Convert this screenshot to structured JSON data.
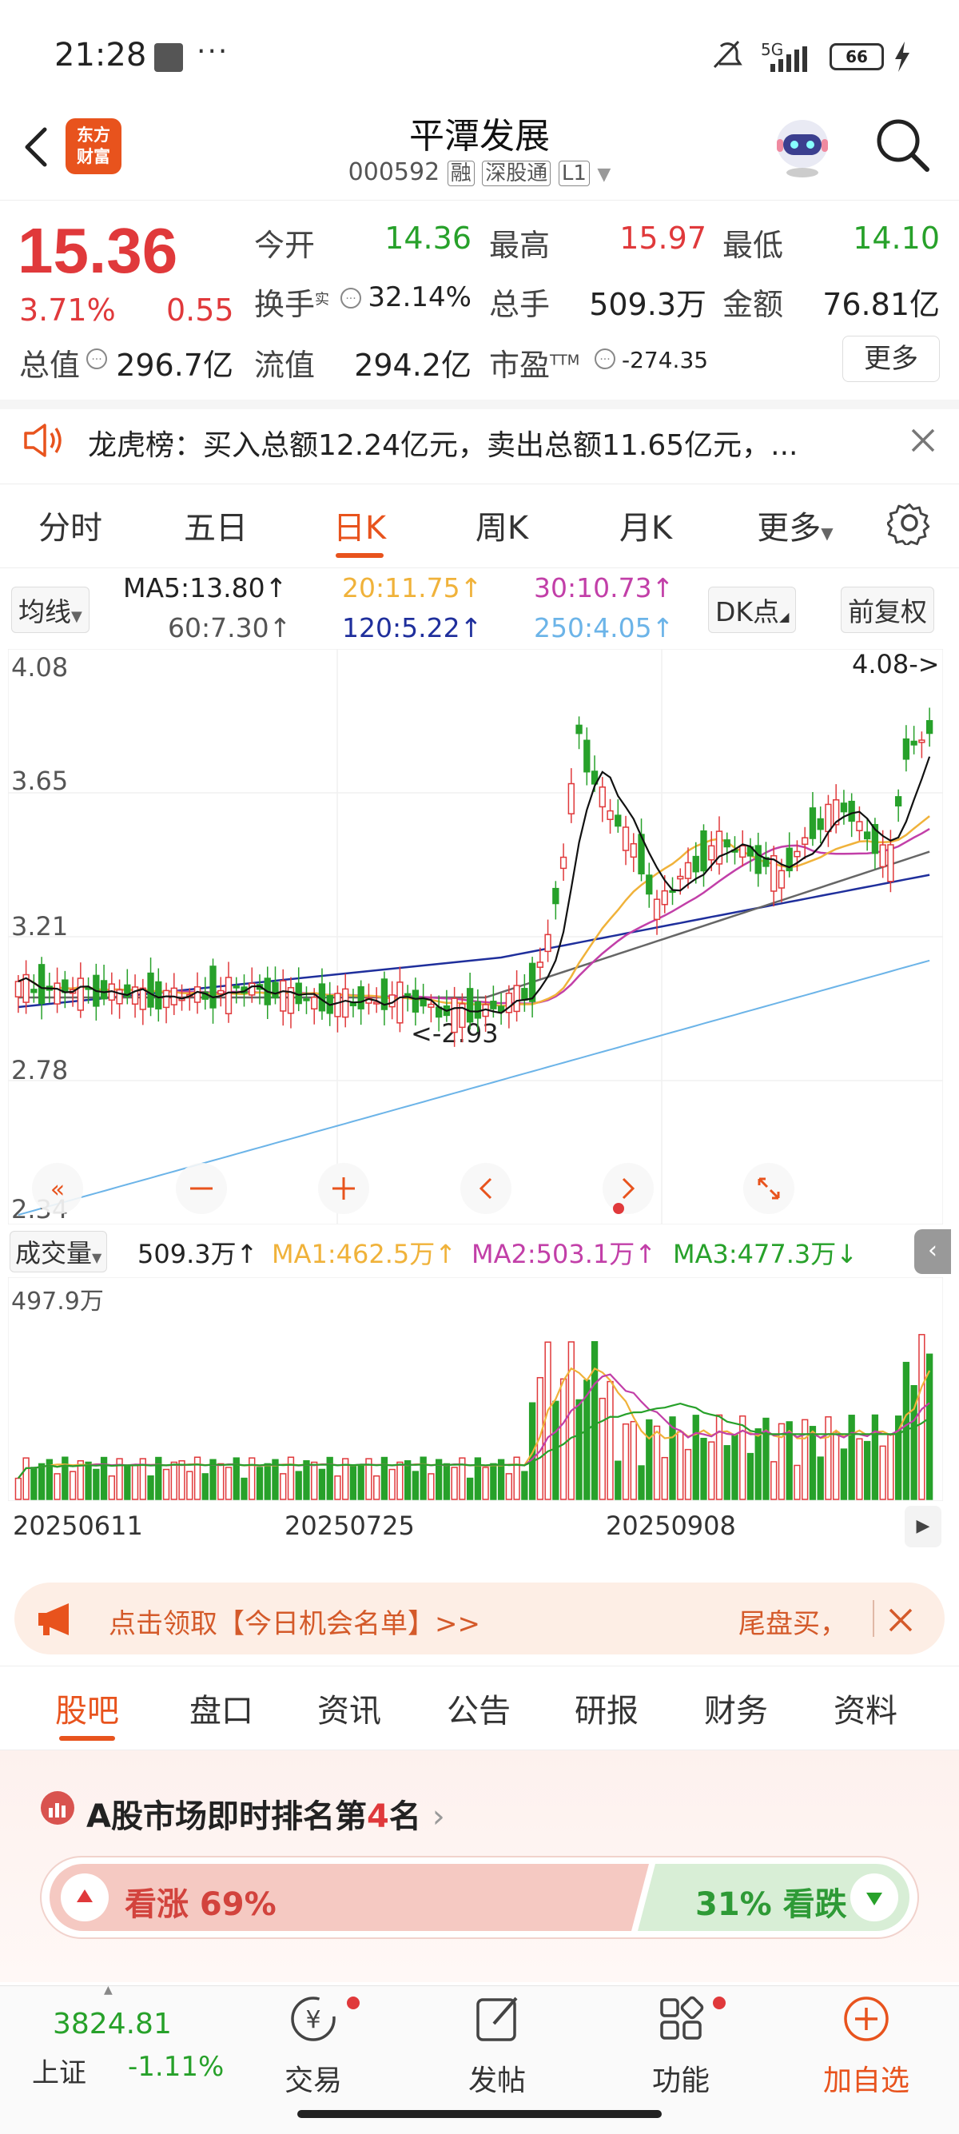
{
  "status_bar": {
    "time": "21:28",
    "dots": "···",
    "network": "5G",
    "battery": "66"
  },
  "header": {
    "logo_line1": "东方",
    "logo_line2": "财富",
    "stock_name": "平潭发展",
    "stock_code": "000592",
    "tag_margin": "融",
    "tag_connect": "深股通",
    "tag_level": "L1"
  },
  "quote": {
    "price": "15.36",
    "change_pct": "3.71%",
    "change_amt": "0.55",
    "items": [
      {
        "label": "今开",
        "value": "14.36",
        "color": "green"
      },
      {
        "label": "最高",
        "value": "15.97",
        "color": "red"
      },
      {
        "label": "最低",
        "value": "14.10",
        "color": "green"
      },
      {
        "label": "换手",
        "sup": "实",
        "value": "32.14%",
        "color": "dark"
      },
      {
        "label": "总手",
        "value": "509.3万",
        "color": "dark"
      },
      {
        "label": "金额",
        "value": "76.81亿",
        "color": "dark"
      },
      {
        "label": "总值",
        "value": "296.7亿",
        "color": "dark"
      },
      {
        "label": "流值",
        "value": "294.2亿",
        "color": "dark"
      },
      {
        "label": "市盈",
        "sup": "TTM",
        "value": "-274.35",
        "color": "dark"
      }
    ],
    "more_label": "更多"
  },
  "notice": {
    "text": "龙虎榜：买入总额12.24亿元，卖出总额11.65亿元，..."
  },
  "period_tabs": [
    "分时",
    "五日",
    "日K",
    "周K",
    "月K",
    "更多"
  ],
  "ma_row": {
    "selector": "均线",
    "ma5": "MA5:13.80",
    "ma20": "20:11.75",
    "ma30": "30:10.73",
    "ma60": "60:7.30",
    "ma120": "120:5.22",
    "ma250": "250:4.05",
    "dk_label": "DK点",
    "adjust_label": "前复权"
  },
  "chart_data": {
    "type": "candlestick",
    "y_axis_labels": [
      "4.08",
      "3.65",
      "3.21",
      "2.78",
      "2.34"
    ],
    "ylim": [
      2.34,
      4.08
    ],
    "high_marker": "4.08->",
    "low_marker": "<-2.93",
    "x_tick_labels": [
      "20250611",
      "20250725",
      "20250908"
    ],
    "colors": {
      "up": "#e0393b",
      "down": "#27a12a",
      "ma5": "#111111",
      "ma20": "#f0b23a",
      "ma30": "#c23fa8",
      "ma60": "#666666",
      "ma120": "#1f2f9c",
      "ma250": "#6cb4e8"
    },
    "volume": {
      "selector": "成交量",
      "current": "509.3万",
      "ma1": "MA1:462.5万",
      "ma2": "MA2:503.1万",
      "ma3": "MA3:477.3万",
      "max_label": "497.9万"
    }
  },
  "promo": {
    "text": "点击领取【今日机会名单】>>",
    "right_text": "尾盘买，"
  },
  "section_tabs": [
    "股吧",
    "盘口",
    "资讯",
    "公告",
    "研报",
    "财务",
    "资料"
  ],
  "ranking": {
    "prefix": "A股市场即时排名第",
    "rank": "4",
    "suffix": "名",
    "up_label": "看涨 69%",
    "down_label": "31% 看跌",
    "up_pct": 69
  },
  "bottom_nav": {
    "index_value": "3824.81",
    "index_name": "上证",
    "index_change": "-1.11%",
    "items": [
      "交易",
      "发帖",
      "功能",
      "加自选"
    ]
  }
}
